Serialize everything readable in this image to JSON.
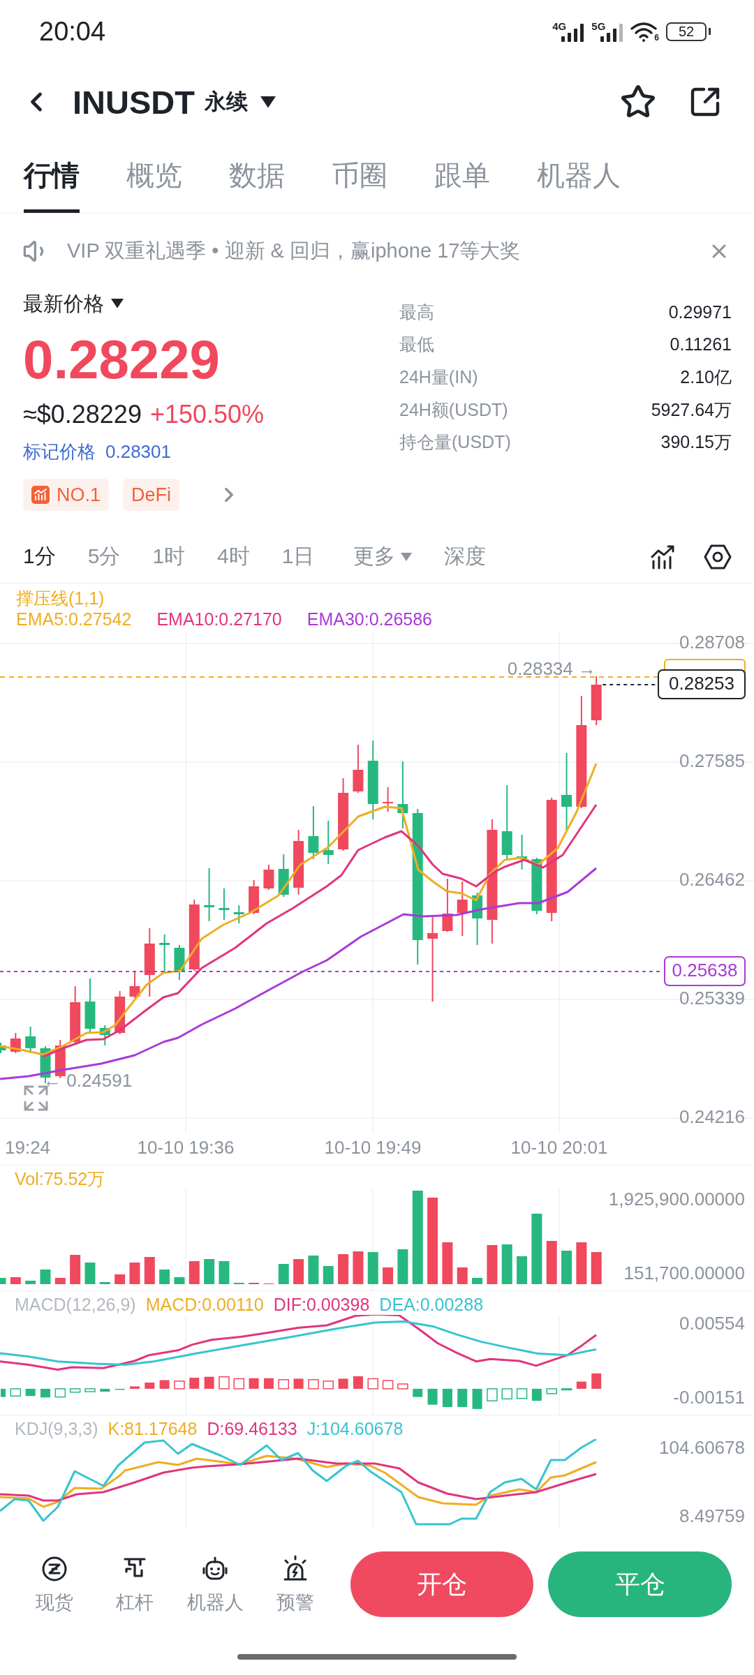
{
  "status_bar": {
    "time": "20:04",
    "networks": [
      {
        "label": "4G"
      },
      {
        "label": "5G"
      }
    ],
    "wifi_badge": "6",
    "battery": "52"
  },
  "header": {
    "symbol": "INUSDT",
    "contract_type": "永续"
  },
  "tabs": [
    {
      "label": "行情",
      "selected": true
    },
    {
      "label": "概览",
      "selected": false
    },
    {
      "label": "数据",
      "selected": false
    },
    {
      "label": "币圈",
      "selected": false
    },
    {
      "label": "跟单",
      "selected": false
    },
    {
      "label": "机器人",
      "selected": false
    }
  ],
  "banner": {
    "text": "VIP 双重礼遇季 • 迎新 & 回归，赢iphone 17等大奖"
  },
  "price": {
    "label": "最新价格",
    "last": "0.28229",
    "usd": "≈$0.28229",
    "change": "+150.50%",
    "mark_label": "标记价格",
    "mark_value": "0.28301",
    "tags": [
      {
        "label": "NO.1",
        "kind": "rank"
      },
      {
        "label": "DeFi",
        "kind": "plain"
      }
    ]
  },
  "stats": [
    {
      "label": "最高",
      "value": "0.29971"
    },
    {
      "label": "最低",
      "value": "0.11261"
    },
    {
      "label": "24H量(IN)",
      "value": "2.10亿"
    },
    {
      "label": "24H额(USDT)",
      "value": "5927.64万"
    },
    {
      "label": "持仓量(USDT)",
      "value": "390.15万"
    }
  ],
  "timeframes": [
    {
      "label": "1分",
      "selected": true,
      "kind": "option"
    },
    {
      "label": "5分",
      "selected": false,
      "kind": "option"
    },
    {
      "label": "1时",
      "selected": false,
      "kind": "option"
    },
    {
      "label": "4时",
      "selected": false,
      "kind": "option"
    },
    {
      "label": "1日",
      "selected": false,
      "kind": "option"
    },
    {
      "label": "更多",
      "selected": false,
      "kind": "dropdown"
    },
    {
      "label": "深度",
      "selected": false,
      "kind": "option"
    }
  ],
  "chart": {
    "indicator": "撑压线(1,1)",
    "legend": [
      {
        "text": "EMA5:0.27542",
        "color": "#eeae22"
      },
      {
        "text": "EMA10:0.27170",
        "color": "#e0357e"
      },
      {
        "text": "EMA30:0.26586",
        "color": "#a83ad8"
      }
    ],
    "y_axis": [
      "0.28708",
      "0.27585",
      "0.26462",
      "0.25339",
      "0.24216"
    ],
    "x_axis": [
      "19:24",
      "10-10 19:36",
      "10-10 19:49",
      "10-10 20:01"
    ],
    "high_label": "0.28334 →",
    "low_label": "← 0.24591",
    "last_price": "0.28253",
    "level_price": "0.25638"
  },
  "volume": {
    "legend": "Vol:75.52万",
    "y_axis": [
      "1,925,900.00000",
      "151,700.00000"
    ]
  },
  "macd": {
    "legend": [
      {
        "text": "MACD(12,26,9)",
        "color": "#b4b9c0"
      },
      {
        "text": "MACD:0.00110",
        "color": "#eeae22"
      },
      {
        "text": "DIF:0.00398",
        "color": "#e0357e"
      },
      {
        "text": "DEA:0.00288",
        "color": "#36c5cf"
      }
    ],
    "y_axis": [
      "0.00554",
      "-0.00151"
    ]
  },
  "kdj": {
    "legend": [
      {
        "text": "KDJ(9,3,3)",
        "color": "#b4b9c0"
      },
      {
        "text": "K:81.17648",
        "color": "#eeae22"
      },
      {
        "text": "D:69.46133",
        "color": "#e0357e"
      },
      {
        "text": "J:104.60678",
        "color": "#36c5cf"
      }
    ],
    "y_axis": [
      "104.60678",
      "8.49759"
    ]
  },
  "bottom_nav": [
    {
      "label": "现货",
      "kind": "spot"
    },
    {
      "label": "杠杆",
      "kind": "margin"
    },
    {
      "label": "机器人",
      "kind": "bot"
    },
    {
      "label": "预警",
      "kind": "alert"
    }
  ],
  "actions": [
    {
      "label": "开仓",
      "kind": "open"
    },
    {
      "label": "平仓",
      "kind": "close"
    }
  ]
}
